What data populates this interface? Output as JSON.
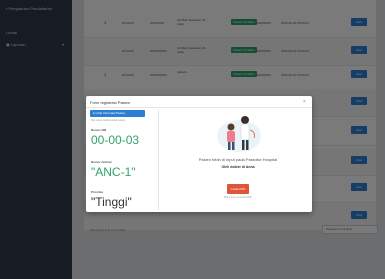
{
  "sidebar": {
    "brand": "Pengaduan Pendaftaran",
    "user": "Lantai",
    "menu_label": "Laporan"
  },
  "table": {
    "rows": [
      {
        "no": "1",
        "c1": "00:00:00",
        "c2": "0001/0000",
        "c3": "Gd.Buol Sulawesi, 01, Jalan",
        "status": "Pasien Terdaftar",
        "c5": "0000000000",
        "c6": "2022-00-00 00:00:00",
        "action": "View"
      },
      {
        "no": "",
        "c1": "00:00:00",
        "c2": "0000000000",
        "c3": "Gd.Buol Sulawesi, 01, Jalan",
        "status": "Pasien Terdaftar",
        "c5": "0000000000",
        "c6": "2022-00-00 00:00:00",
        "action": "View"
      },
      {
        "no": "1",
        "c1": "00:00:00",
        "c2": "0000000000",
        "c3": "Jakarta",
        "status": "Pasien Terdaftar",
        "c5": "0000000000",
        "c6": "2022-00-00 00:00:00",
        "action": "View"
      },
      {
        "no": "",
        "c1": "00:00:00",
        "c2": "0000000000",
        "c3": "Jakarta",
        "status": "Pasien Terdaftar",
        "c5": "0000000000",
        "c6": "2022-00-00 00:00:00",
        "action": "View"
      },
      {
        "no": "",
        "c1": "",
        "c2": "",
        "c3": "",
        "status": "",
        "c5": "",
        "c6": "",
        "action": "View"
      },
      {
        "no": "",
        "c1": "",
        "c2": "",
        "c3": "",
        "status": "",
        "c5": "",
        "c6": "",
        "action": "View"
      },
      {
        "no": "",
        "c1": "",
        "c2": "",
        "c3": "",
        "status": "",
        "c5": "",
        "c6": "",
        "action": "View"
      },
      {
        "no": "",
        "c1": "",
        "c2": "",
        "c3": "",
        "status": "",
        "c5": "",
        "c6": "",
        "action": "View"
      }
    ],
    "footer_info": "Showing 1 to 8 of 8 entries",
    "pager": "Previous 1 2 3 Next"
  },
  "modal": {
    "title": "Form registrasi Pasien",
    "info_button": "Lihat Informasi Pasien",
    "hint": "Klik untuk melihat detail pasien",
    "nomor_rm_label": "Nomor RM",
    "nomor_rm_value": "00-00-03",
    "nomor_antrian_label": "Nomor Antrian",
    "nomor_antrian_value": "\"ANC-1\"",
    "prioritas_label": "Prioritas",
    "prioritas_value": "\"Tinggi\"",
    "message": "Pasien telah di input pada Paradise Hospital",
    "message_sub": "Oleh dokter di Anna",
    "pdf_button": "Cetak PDF",
    "pdf_hint": "Klik untuk mencetak PDF",
    "close_glyph": "×"
  },
  "colors": {
    "sidebar": "#2f3b48",
    "primary": "#2d7fd3",
    "success": "#2fa36b",
    "danger": "#e05539",
    "teal_value": "#2fa36b"
  }
}
